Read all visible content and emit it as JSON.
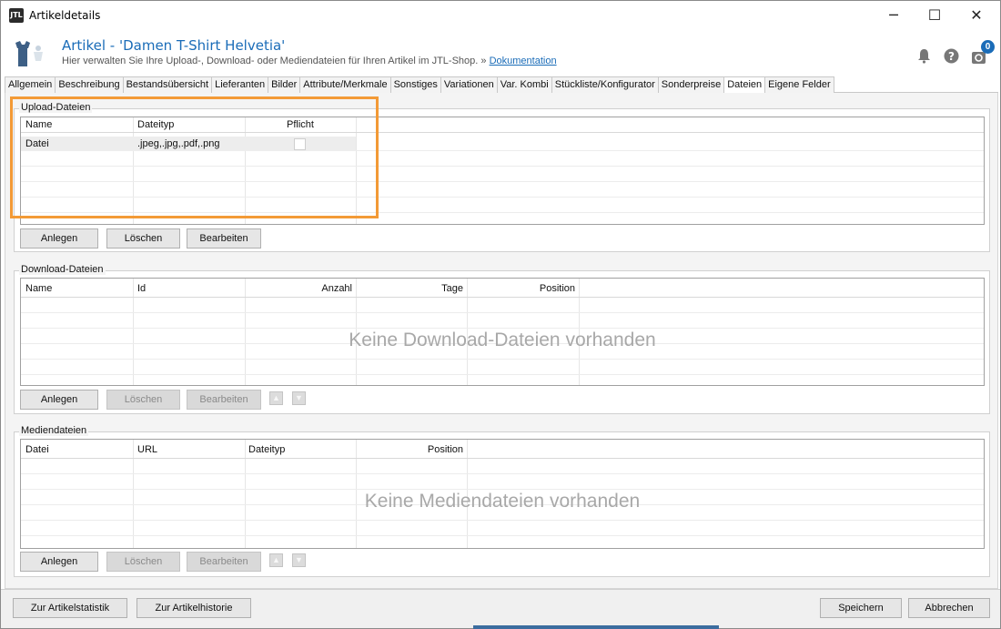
{
  "window": {
    "title": "Artikeldetails",
    "app_icon_text": "JTL",
    "minimize": "─",
    "maximize": "☐",
    "close": "✕"
  },
  "header": {
    "title": "Artikel - 'Damen T-Shirt Helvetia'",
    "subtitle": "Hier verwalten Sie Ihre Upload-, Download- oder Mediendateien für Ihren Artikel im JTL-Shop. »",
    "doc_link": "Dokumentation",
    "notification_badge": "0",
    "icons": [
      "bell-icon",
      "help-icon",
      "refresh-icon"
    ]
  },
  "tabs": [
    {
      "label": "Allgemein",
      "active": false
    },
    {
      "label": "Beschreibung",
      "active": false
    },
    {
      "label": "Bestandsübersicht",
      "active": false
    },
    {
      "label": "Lieferanten",
      "active": false
    },
    {
      "label": "Bilder",
      "active": false
    },
    {
      "label": "Attribute/Merkmale",
      "active": false
    },
    {
      "label": "Sonstiges",
      "active": false
    },
    {
      "label": "Variationen",
      "active": false
    },
    {
      "label": "Var. Kombi",
      "active": false
    },
    {
      "label": "Stückliste/Konfigurator",
      "active": false
    },
    {
      "label": "Sonderpreise",
      "active": false
    },
    {
      "label": "Dateien",
      "active": true
    },
    {
      "label": "Eigene Felder",
      "active": false
    }
  ],
  "upload": {
    "legend": "Upload-Dateien",
    "columns": [
      "Name",
      "Dateityp",
      "Pflicht"
    ],
    "rows": [
      {
        "name": "Datei",
        "type": ".jpeg,.jpg,.pdf,.png",
        "required": false
      }
    ],
    "buttons": {
      "add": "Anlegen",
      "delete": "Löschen",
      "edit": "Bearbeiten"
    }
  },
  "download": {
    "legend": "Download-Dateien",
    "columns": [
      "Name",
      "Id",
      "Anzahl",
      "Tage",
      "Position"
    ],
    "empty_text": "Keine Download-Dateien vorhanden",
    "buttons": {
      "add": "Anlegen",
      "delete": "Löschen",
      "edit": "Bearbeiten"
    }
  },
  "media": {
    "legend": "Mediendateien",
    "columns": [
      "Datei",
      "URL",
      "Dateityp",
      "Position"
    ],
    "empty_text": "Keine Mediendateien vorhanden",
    "buttons": {
      "add": "Anlegen",
      "delete": "Löschen",
      "edit": "Bearbeiten"
    }
  },
  "footer": {
    "stats_button": "Zur Artikelstatistik",
    "history_button": "Zur Artikelhistorie",
    "save_button": "Speichern",
    "cancel_button": "Abbrechen"
  },
  "colors": {
    "accent": "#1a6cb8",
    "highlight": "#f39a36"
  }
}
